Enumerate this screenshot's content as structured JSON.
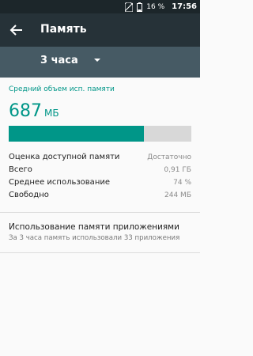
{
  "status_bar": {
    "battery": "16 %",
    "time": "17:56"
  },
  "toolbar": {
    "title": "Память"
  },
  "period": {
    "selected": "3 часа"
  },
  "summary": {
    "heading": "Средний объем исп. памяти",
    "value": "687",
    "unit": "МБ",
    "usage_fraction": 0.74,
    "accent_color": "#009688"
  },
  "stats": [
    {
      "label": "Оценка доступной памяти",
      "value": "Достаточно"
    },
    {
      "label": "Всего",
      "value": "0,91 ГБ"
    },
    {
      "label": "Среднее использование",
      "value": "74 %"
    },
    {
      "label": "Свободно",
      "value": "244 МБ"
    }
  ],
  "apps_section": {
    "title": "Использование памяти приложениями",
    "subtitle": "За 3 часа память использовали 33 приложения"
  }
}
